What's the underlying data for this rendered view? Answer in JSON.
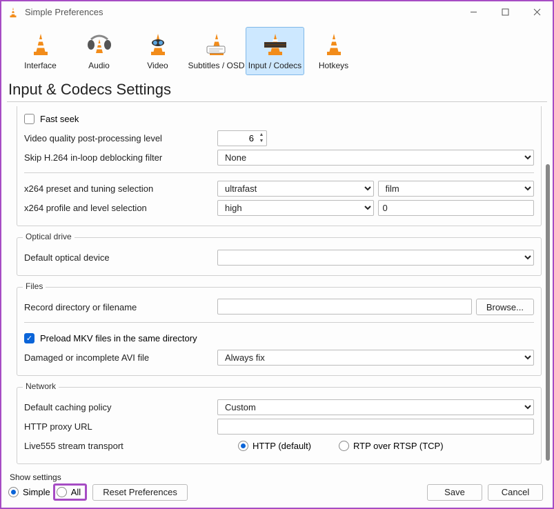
{
  "window": {
    "title": "Simple Preferences"
  },
  "toolbar": {
    "items": [
      {
        "label": "Interface"
      },
      {
        "label": "Audio"
      },
      {
        "label": "Video"
      },
      {
        "label": "Subtitles / OSD"
      },
      {
        "label": "Input / Codecs"
      },
      {
        "label": "Hotkeys"
      }
    ]
  },
  "page": {
    "title": "Input & Codecs Settings"
  },
  "codecs": {
    "fast_seek_label": "Fast seek",
    "vq_label": "Video quality post-processing level",
    "vq_value": "6",
    "skip_label": "Skip H.264 in-loop deblocking filter",
    "skip_value": "None",
    "x264_preset_label": "x264 preset and tuning selection",
    "x264_preset_a": "ultrafast",
    "x264_preset_b": "film",
    "x264_profile_label": "x264 profile and level selection",
    "x264_profile_a": "high",
    "x264_profile_b": "0"
  },
  "optical": {
    "legend": "Optical drive",
    "default_label": "Default optical device",
    "default_value": ""
  },
  "files": {
    "legend": "Files",
    "record_label": "Record directory or filename",
    "record_value": "",
    "browse": "Browse...",
    "preload_label": "Preload MKV files in the same directory",
    "avi_label": "Damaged or incomplete AVI file",
    "avi_value": "Always fix"
  },
  "network": {
    "legend": "Network",
    "cache_label": "Default caching policy",
    "cache_value": "Custom",
    "proxy_label": "HTTP proxy URL",
    "proxy_value": "",
    "live555_label": "Live555 stream transport",
    "http_opt": "HTTP (default)",
    "rtp_opt": "RTP over RTSP (TCP)"
  },
  "footer": {
    "legend": "Show settings",
    "simple": "Simple",
    "all": "All",
    "reset": "Reset Preferences",
    "save": "Save",
    "cancel": "Cancel"
  }
}
